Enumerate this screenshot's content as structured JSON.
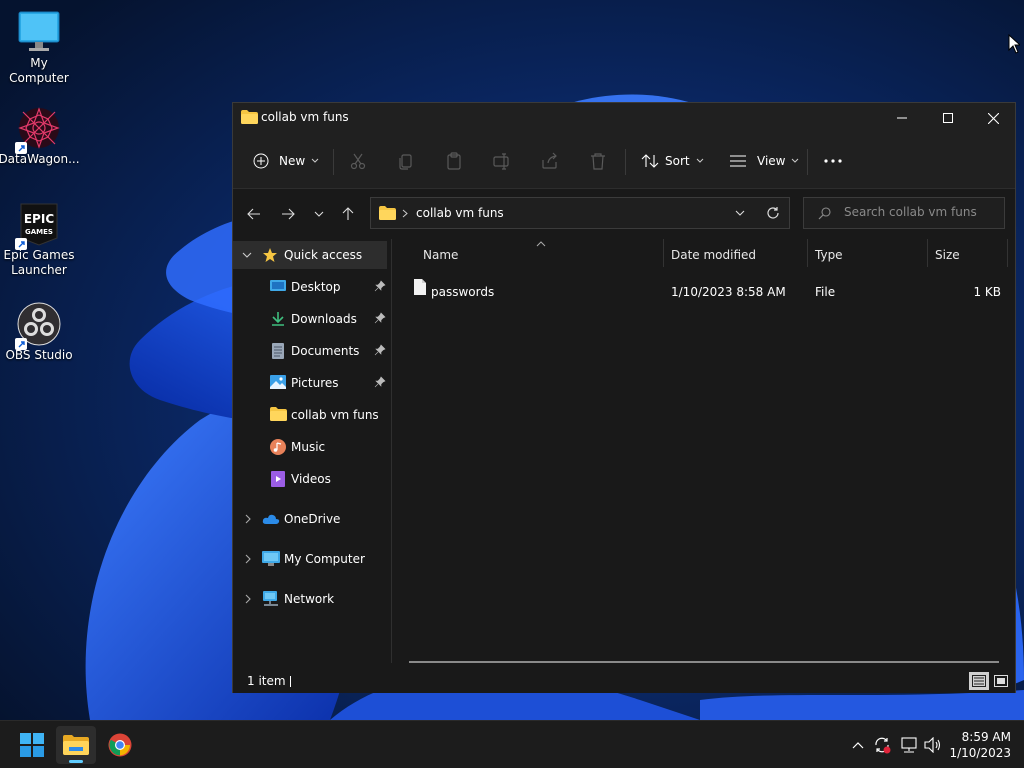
{
  "desktop": {
    "icons": [
      {
        "label": "My Computer",
        "icon": "monitor-icon"
      },
      {
        "label": "DataWagon...",
        "icon": "datawagon-icon"
      },
      {
        "label": "Epic Games\nLauncher",
        "icon": "epic-games-icon",
        "logo_text": "EPIC GAMES"
      },
      {
        "label": "OBS Studio",
        "icon": "obs-icon"
      }
    ]
  },
  "window": {
    "title": "collab vm funs",
    "controls": [
      "minimize",
      "maximize",
      "close"
    ]
  },
  "toolbar": {
    "new_label": "New",
    "sort_label": "Sort",
    "view_label": "View",
    "icons": [
      "cut-icon",
      "copy-icon",
      "paste-icon",
      "rename-icon",
      "share-icon",
      "delete-icon",
      "more-icon"
    ]
  },
  "address": {
    "path": "collab vm funs",
    "search_placeholder": "Search collab vm funs"
  },
  "nav": {
    "quick_access": "Quick access",
    "items": [
      {
        "label": "Desktop",
        "pinned": true,
        "icon": "desktop-folder-icon"
      },
      {
        "label": "Downloads",
        "pinned": true,
        "icon": "downloads-icon"
      },
      {
        "label": "Documents",
        "pinned": true,
        "icon": "documents-icon"
      },
      {
        "label": "Pictures",
        "pinned": true,
        "icon": "pictures-icon"
      },
      {
        "label": "collab vm funs",
        "pinned": false,
        "icon": "folder-icon"
      },
      {
        "label": "Music",
        "pinned": false,
        "icon": "music-icon"
      },
      {
        "label": "Videos",
        "pinned": false,
        "icon": "videos-icon"
      }
    ],
    "roots": [
      {
        "label": "OneDrive",
        "icon": "onedrive-icon"
      },
      {
        "label": "My Computer",
        "icon": "computer-icon"
      },
      {
        "label": "Network",
        "icon": "network-icon"
      }
    ]
  },
  "list": {
    "columns": [
      "Name",
      "Date modified",
      "Type",
      "Size"
    ],
    "rows": [
      {
        "name": "passwords",
        "date": "1/10/2023 8:58 AM",
        "type": "File",
        "size": "1 KB"
      }
    ]
  },
  "status": {
    "item_count": "1 item"
  },
  "taskbar": {
    "time": "8:59 AM",
    "date": "1/10/2023",
    "apps": [
      "start-icon",
      "file-explorer-icon",
      "chrome-icon"
    ]
  },
  "colors": {
    "accent": "#60cdff",
    "window_bg": "#191919",
    "taskbar_bg": "#1c1c1c"
  }
}
